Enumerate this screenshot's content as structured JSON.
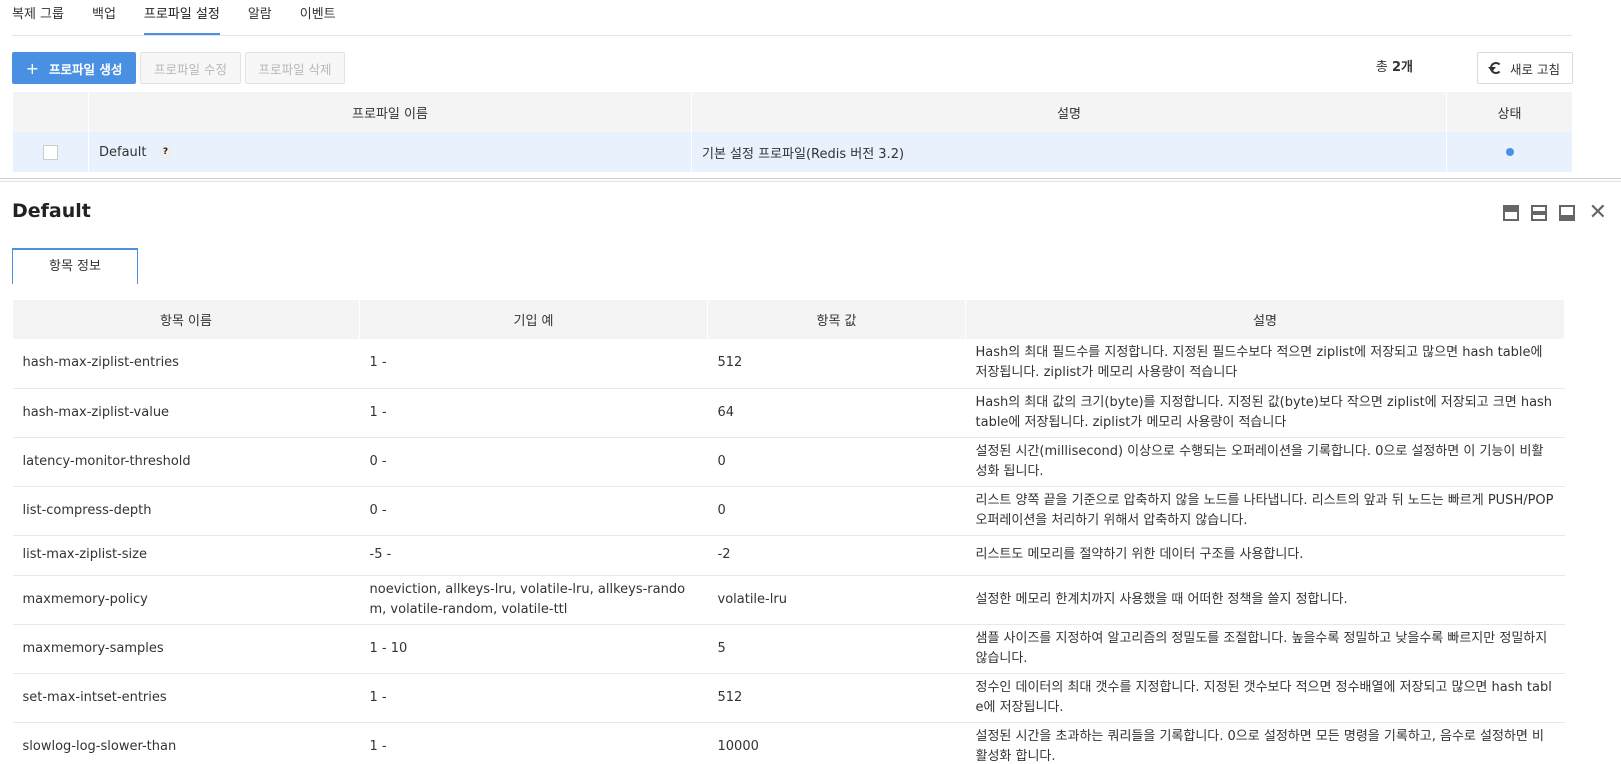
{
  "tabs": [
    "복제 그룹",
    "백업",
    "프로파일 설정",
    "알람",
    "이벤트"
  ],
  "active_tab_index": 2,
  "toolbar": {
    "create_label": "프로파일 생성",
    "edit_label": "프로파일 수정",
    "delete_label": "프로파일 삭제",
    "count_prefix": "총 ",
    "count_value": "2개",
    "refresh_label": "새로 고침"
  },
  "profile_table": {
    "headers": [
      "프로파일 이름",
      "설명",
      "상태"
    ],
    "row": {
      "name": "Default",
      "help": "?",
      "description": "기본 설정 프로파일(Redis 버전 3.2)"
    }
  },
  "detail": {
    "title": "Default",
    "tab_label": "항목 정보",
    "headers": [
      "항목 이름",
      "기입 예",
      "항목 값",
      "설명"
    ],
    "rows": [
      {
        "name": "hash-max-ziplist-entries",
        "example": "1 -",
        "value": "512",
        "desc": "Hash의 최대 필드수를 지정합니다. 지정된 필드수보다 적으면 ziplist에 저장되고 많으면 hash table에 저장됩니다. ziplist가 메모리 사용량이 적습니다"
      },
      {
        "name": "hash-max-ziplist-value",
        "example": "1 -",
        "value": "64",
        "desc": "Hash의 최대 값의 크기(byte)를 지정합니다. 지정된 값(byte)보다 작으면 ziplist에 저장되고 크면 hash table에 저장됩니다. ziplist가 메모리 사용량이 적습니다"
      },
      {
        "name": "latency-monitor-threshold",
        "example": "0 -",
        "value": "0",
        "desc": "설정된 시간(millisecond) 이상으로 수행되는 오퍼레이션을 기록합니다. 0으로 설정하면 이 기능이 비활성화 됩니다."
      },
      {
        "name": "list-compress-depth",
        "example": "0 -",
        "value": "0",
        "desc": "리스트 양쪽 끝을 기준으로 압축하지 않을 노드를 나타냅니다. 리스트의 앞과 뒤 노드는 빠르게 PUSH/POP 오퍼레이션을 처리하기 위해서 압축하지 않습니다."
      },
      {
        "name": "list-max-ziplist-size",
        "example": "-5 -",
        "value": "-2",
        "desc": "리스트도 메모리를 절약하기 위한 데이터 구조를 사용합니다."
      },
      {
        "name": "maxmemory-policy",
        "example": "noeviction, allkeys-lru, volatile-lru, allkeys-random, volatile-random, volatile-ttl",
        "value": "volatile-lru",
        "desc": "설정한 메모리 한계치까지 사용했을 때 어떠한 정책을 쓸지 정합니다."
      },
      {
        "name": "maxmemory-samples",
        "example": "1 - 10",
        "value": "5",
        "desc": "샘플 사이즈를 지정하여 알고리즘의 정밀도를 조절합니다. 높을수록 정밀하고 낮을수록 빠르지만 정밀하지 않습니다."
      },
      {
        "name": "set-max-intset-entries",
        "example": "1 -",
        "value": "512",
        "desc": "정수인 데이터의 최대 갯수를 지정합니다. 지정된 갯수보다 적으면 정수배열에 저장되고 많으면 hash table에 저장됩니다."
      },
      {
        "name": "slowlog-log-slower-than",
        "example": "1 -",
        "value": "10000",
        "desc": "설정된 시간을 초과하는 쿼리들을 기록합니다. 0으로 설정하면 모든 명령을 기록하고, 음수로 설정하면 비활성화 합니다."
      }
    ]
  },
  "colors": {
    "accent": "#4a90e2",
    "selected_row": "#e8f1fc",
    "header_bg": "#f4f4f4"
  }
}
